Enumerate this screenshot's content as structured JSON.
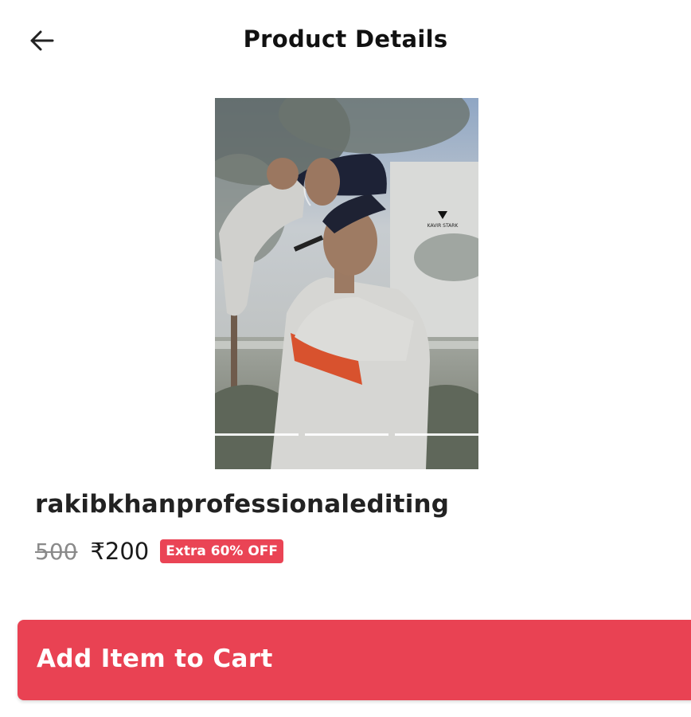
{
  "header": {
    "title": "Product Details",
    "back_icon": "arrow-left-icon"
  },
  "product": {
    "image_alt": "Product photo",
    "watermark": "KAVIR STARK",
    "slide_count": 3,
    "active_slide": 1,
    "name": "rakibkhanprofessionalediting",
    "old_price": "500",
    "price": "₹200",
    "discount": "Extra 60% OFF"
  },
  "cart": {
    "button_label": "Add Item to Cart"
  },
  "colors": {
    "accent": "#e94253",
    "badge": "#ea4455",
    "text": "#1a1a1a",
    "muted": "#8a8a8a"
  }
}
